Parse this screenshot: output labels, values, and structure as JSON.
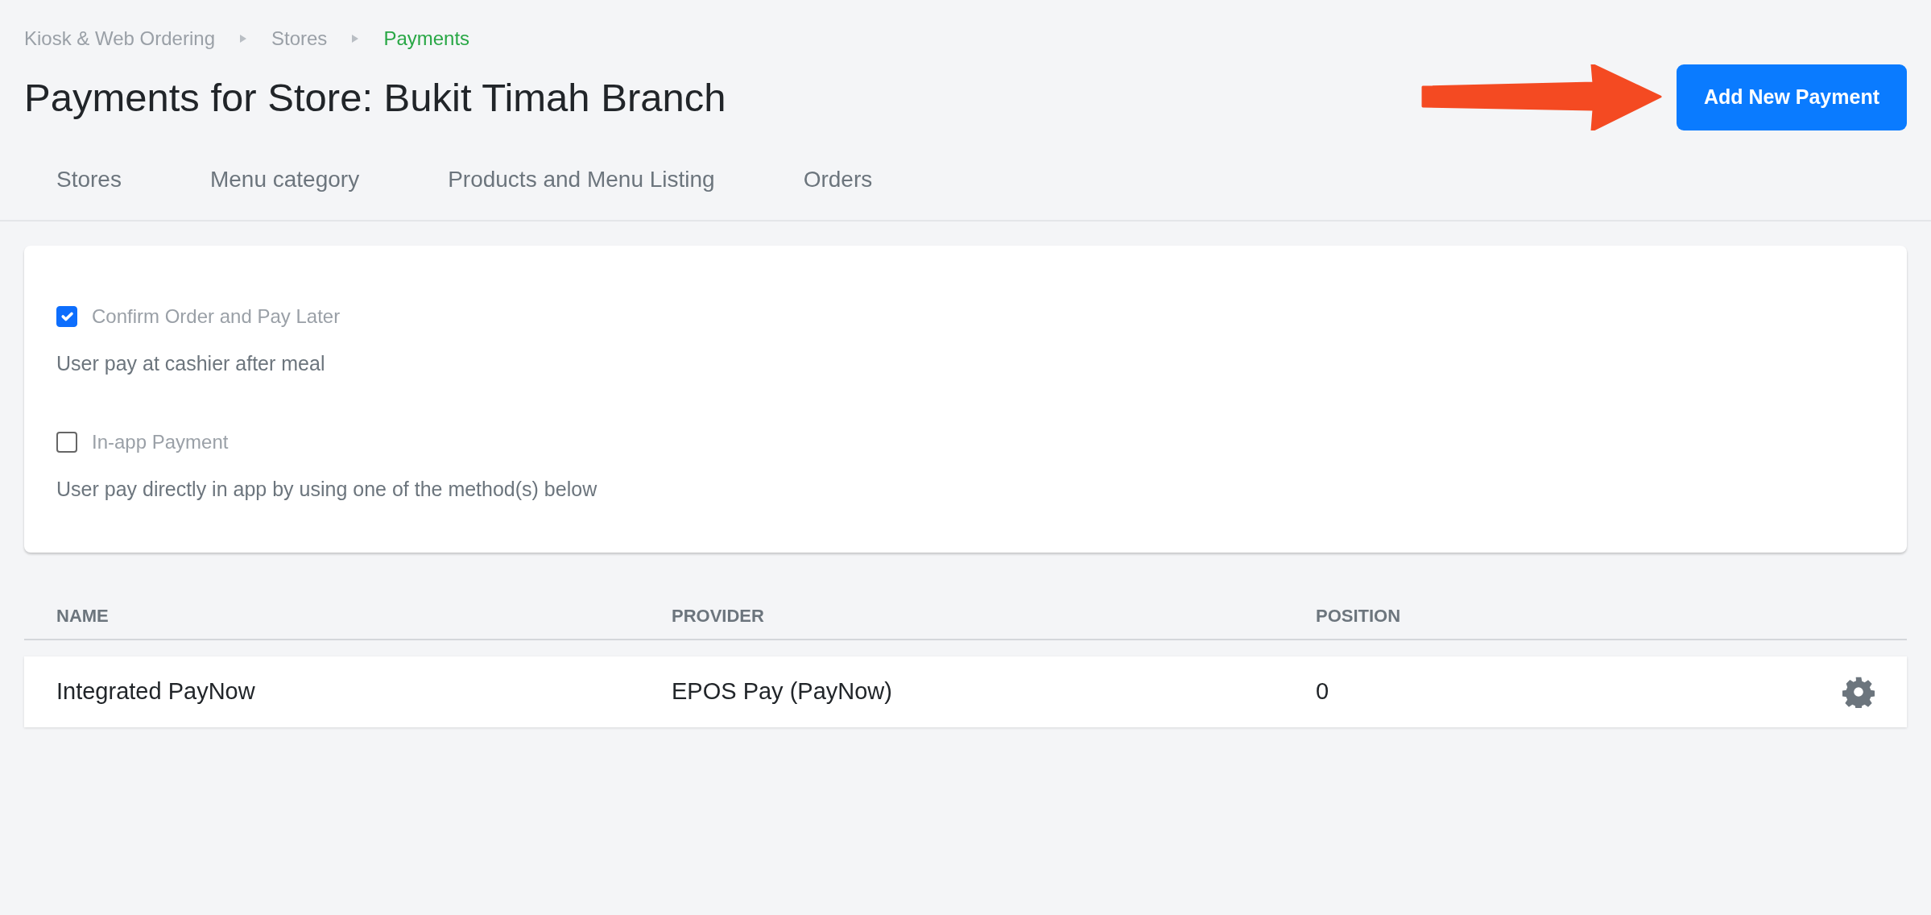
{
  "breadcrumb": [
    {
      "label": "Kiosk & Web Ordering",
      "selected": false
    },
    {
      "label": "Stores",
      "selected": false
    },
    {
      "label": "Payments",
      "selected": true
    }
  ],
  "page_title": "Payments for Store: Bukit Timah Branch",
  "add_button": "Add New Payment",
  "tabs": [
    {
      "label": "Stores",
      "selected": false
    },
    {
      "label": "Menu category",
      "selected": false
    },
    {
      "label": "Products and Menu Listing",
      "selected": false
    },
    {
      "label": "Orders",
      "selected": false
    }
  ],
  "payment_options": [
    {
      "label": "Confirm Order and Pay Later",
      "checked": true,
      "description": "User pay at cashier after meal"
    },
    {
      "label": "In-app Payment",
      "checked": false,
      "description": "User pay directly in app by using one of the method(s) below"
    }
  ],
  "table": {
    "columns": [
      "NAME",
      "PROVIDER",
      "POSITION"
    ],
    "rows": [
      {
        "cells": [
          "Integrated PayNow",
          "EPOS Pay (PayNow)",
          "0"
        ]
      }
    ]
  }
}
